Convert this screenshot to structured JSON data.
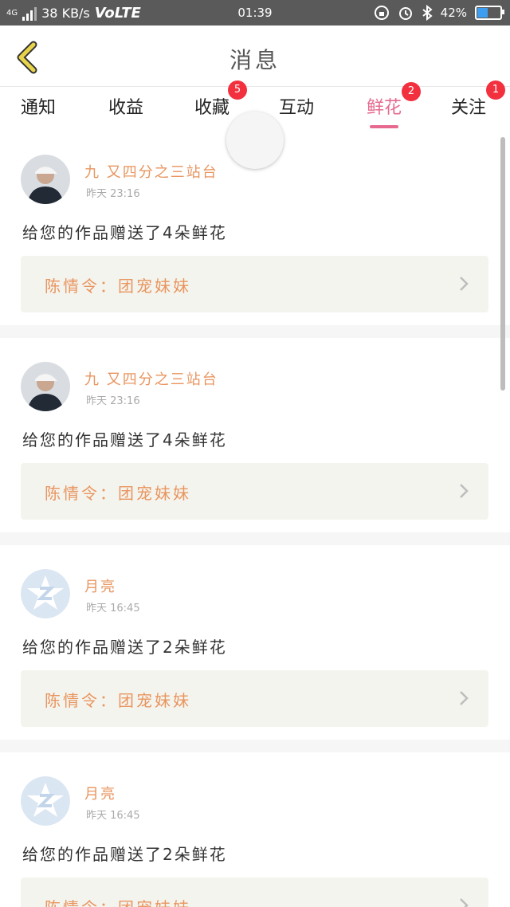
{
  "status_bar": {
    "network": "4G",
    "speed": "38 KB/s",
    "volte": "VoLTE",
    "time": "01:39",
    "battery": "42%"
  },
  "header": {
    "title": "消息"
  },
  "tabs": [
    {
      "label": "通知",
      "badge": ""
    },
    {
      "label": "收益",
      "badge": ""
    },
    {
      "label": "收藏",
      "badge": "5"
    },
    {
      "label": "互动",
      "badge": ""
    },
    {
      "label": "鲜花",
      "badge": "2",
      "active": true
    },
    {
      "label": "关注",
      "badge": "1"
    }
  ],
  "messages": [
    {
      "user": "九 又四分之三站台",
      "time": "昨天 23:16",
      "text": "给您的作品赠送了4朵鲜花",
      "work": "陈情令：团宠妹妹",
      "avatar": "photo-avatar"
    },
    {
      "user": "九 又四分之三站台",
      "time": "昨天 23:16",
      "text": "给您的作品赠送了4朵鲜花",
      "work": "陈情令：团宠妹妹",
      "avatar": "photo-avatar"
    },
    {
      "user": "月亮",
      "time": "昨天 16:45",
      "text": "给您的作品赠送了2朵鲜花",
      "work": "陈情令：团宠妹妹",
      "avatar": "default-avatar"
    },
    {
      "user": "月亮",
      "time": "昨天 16:45",
      "text": "给您的作品赠送了2朵鲜花",
      "work": "陈情令：团宠妹妹",
      "avatar": "default-avatar"
    }
  ],
  "colors": {
    "accent": "#e66a8f",
    "username": "#e8955f",
    "badge": "#f2303e",
    "back_arrow": "#e8d44a"
  }
}
